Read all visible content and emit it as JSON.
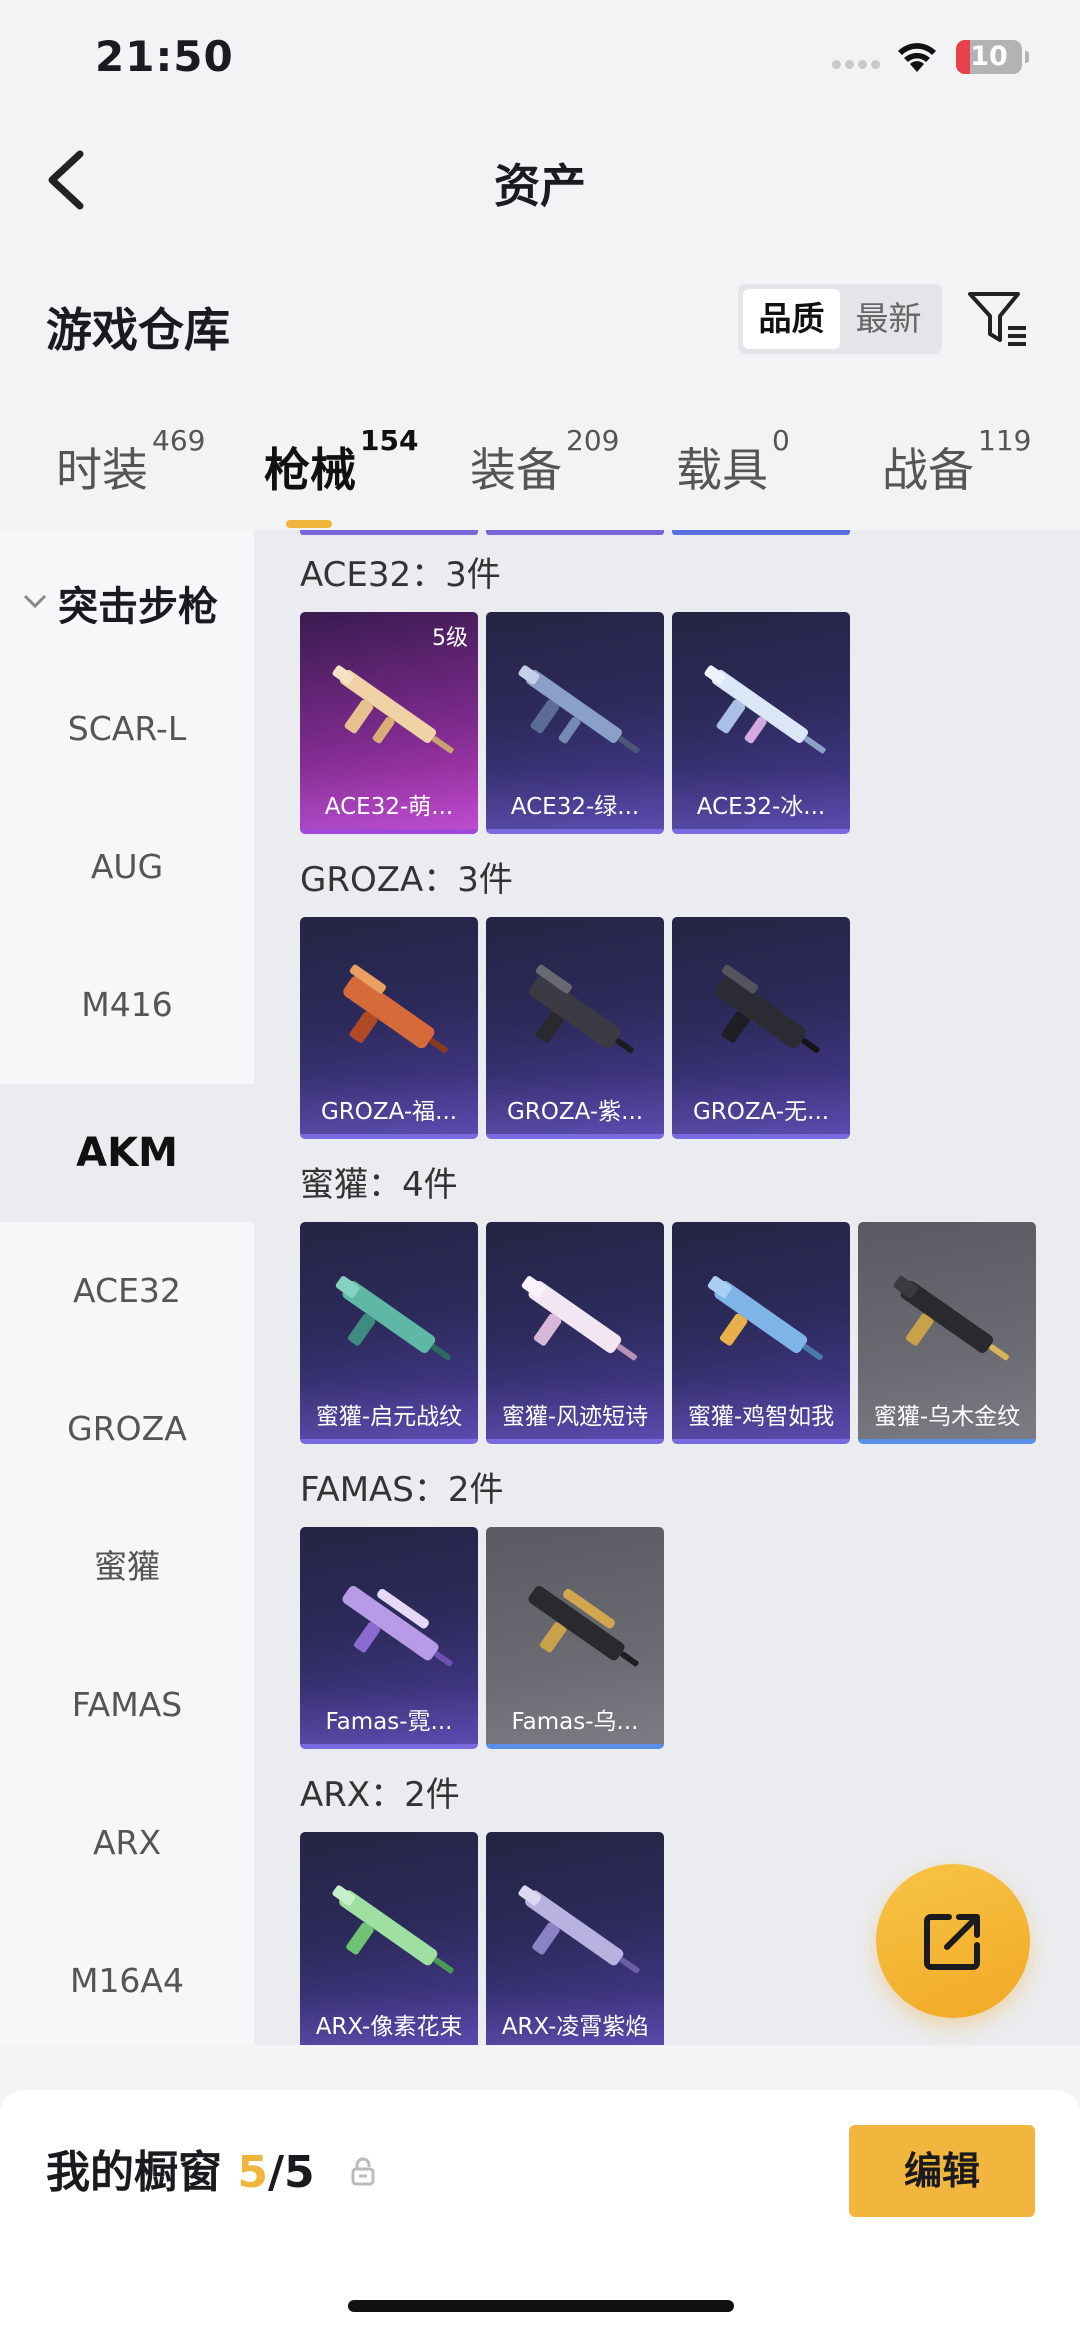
{
  "status": {
    "time": "21:50",
    "battery": "10"
  },
  "header": {
    "title": "资产"
  },
  "warehouse": {
    "title": "游戏仓库",
    "sort": [
      "品质",
      "最新"
    ]
  },
  "tabs": [
    {
      "label": "时装",
      "count": "469"
    },
    {
      "label": "枪械",
      "count": "154"
    },
    {
      "label": "装备",
      "count": "209"
    },
    {
      "label": "载具",
      "count": "0"
    },
    {
      "label": "战备",
      "count": "119"
    }
  ],
  "sidebar": {
    "group": "突击步枪",
    "items": [
      "SCAR-L",
      "AUG",
      "M416",
      "AKM",
      "ACE32",
      "GROZA",
      "蜜獾",
      "FAMAS",
      "ARX",
      "M16A4"
    ]
  },
  "sections": [
    {
      "title": "ACE32：3件",
      "items": [
        {
          "name": "ACE32-萌...",
          "level": "5级"
        },
        {
          "name": "ACE32-绿..."
        },
        {
          "name": "ACE32-冰..."
        }
      ]
    },
    {
      "title": "GROZA：3件",
      "items": [
        {
          "name": "GROZA-福..."
        },
        {
          "name": "GROZA-紫..."
        },
        {
          "name": "GROZA-无..."
        }
      ]
    },
    {
      "title": "蜜獾：4件",
      "items": [
        {
          "name": "蜜獾-启元战纹"
        },
        {
          "name": "蜜獾-风迹短诗"
        },
        {
          "name": "蜜獾-鸡智如我"
        },
        {
          "name": "蜜獾-乌木金纹"
        }
      ]
    },
    {
      "title": "FAMAS：2件",
      "items": [
        {
          "name": "Famas-霓..."
        },
        {
          "name": "Famas-乌..."
        }
      ]
    },
    {
      "title": "ARX：2件",
      "items": [
        {
          "name": "ARX-像素花束"
        },
        {
          "name": "ARX-凌霄紫焰"
        }
      ]
    }
  ],
  "bottom": {
    "title": "我的橱窗",
    "count": "5",
    "total": "/5",
    "edit_label": "编辑"
  },
  "colors": {
    "accent": "#f0b53b",
    "card_purple": "#4b3d9c",
    "card_pink": "#c13ec3",
    "card_gray": "#6a6b72"
  }
}
